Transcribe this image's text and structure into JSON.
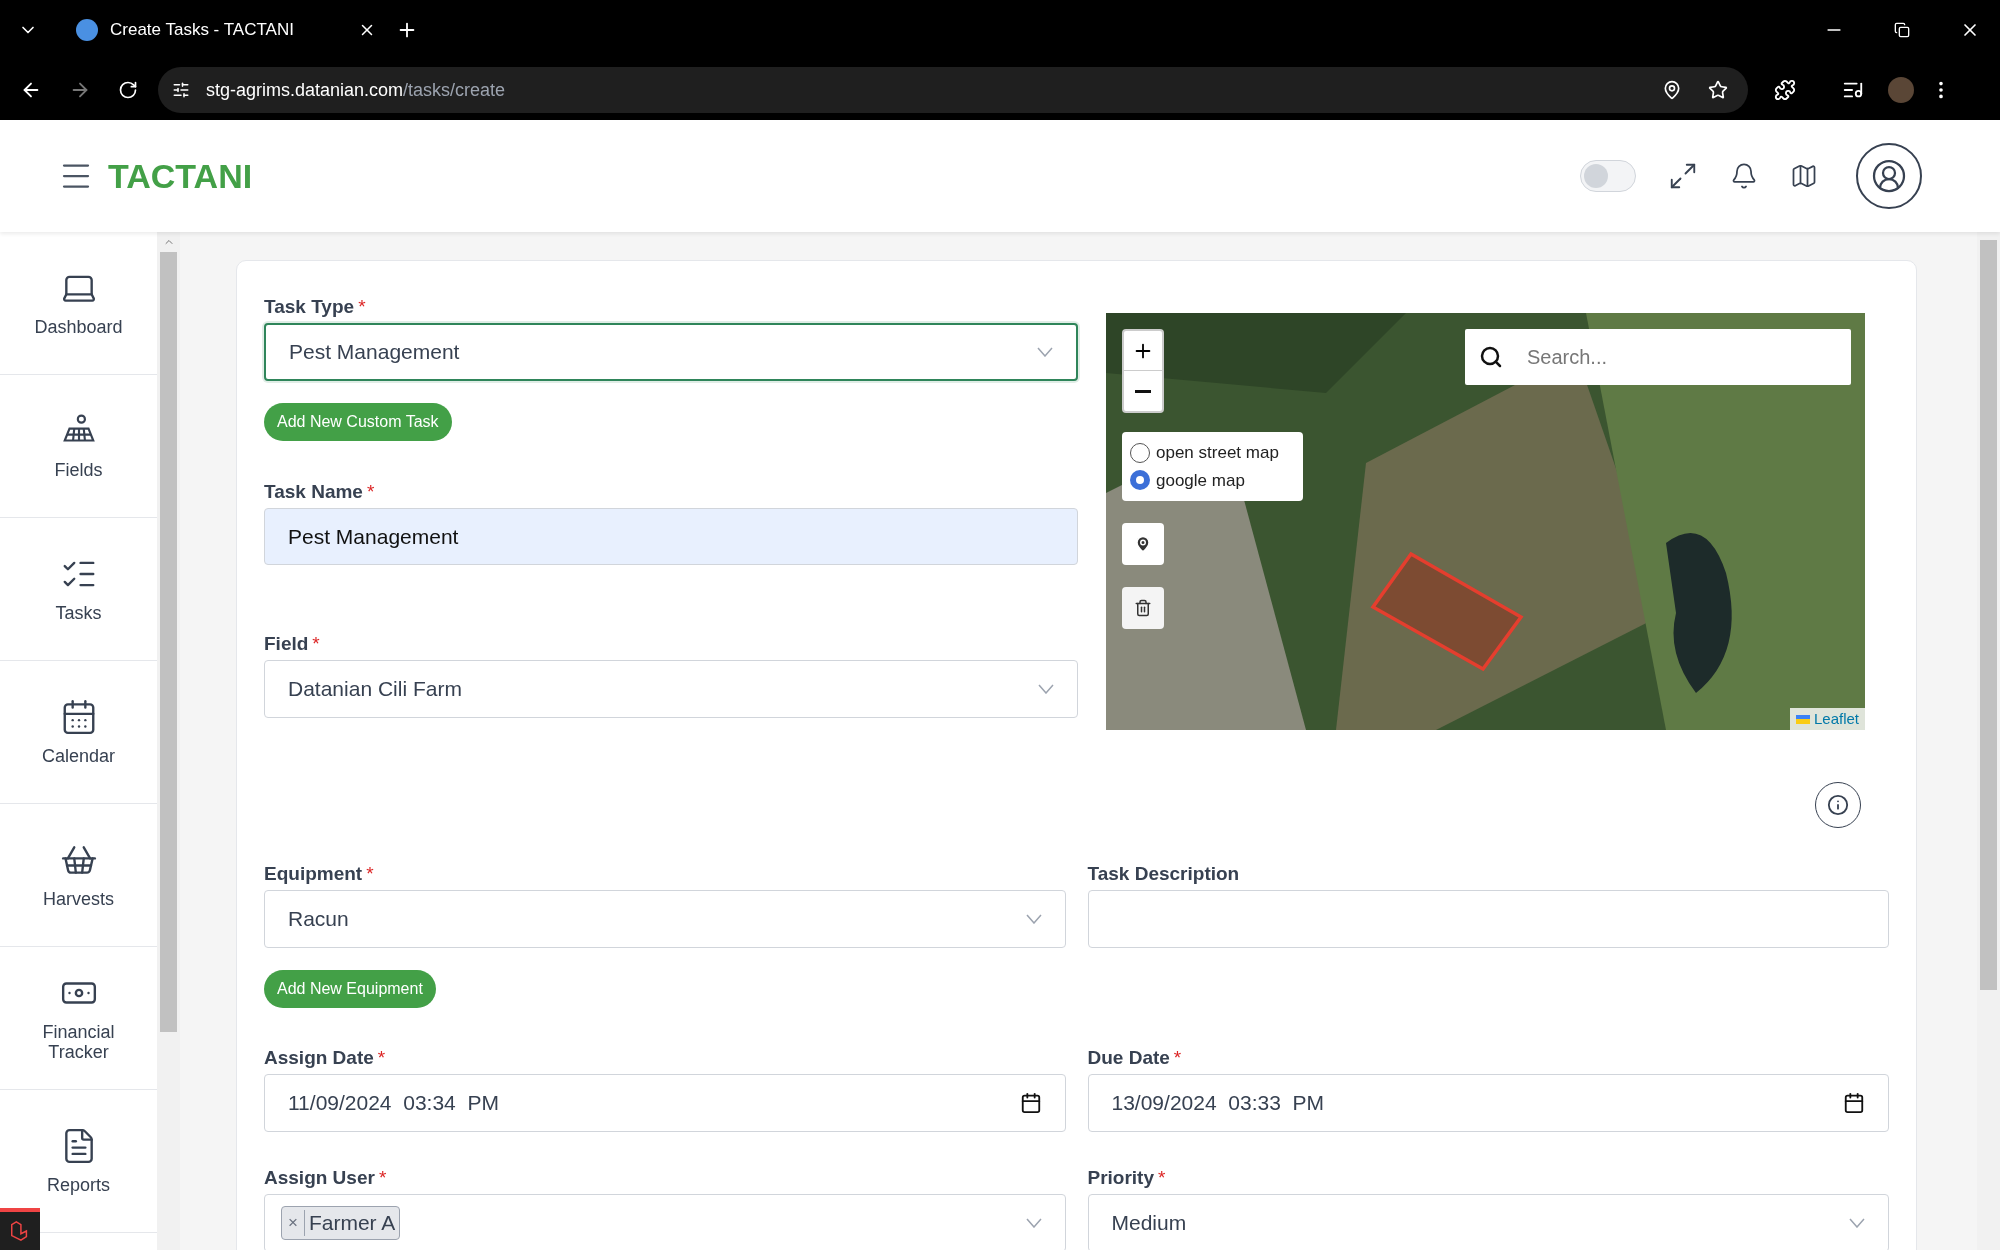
{
  "browser": {
    "tab_title": "Create Tasks - TACTANI",
    "url_host": "stg-agrims.datanian.com",
    "url_path": "/tasks/create"
  },
  "header": {
    "brand": "TACTANI",
    "toggle_on": false
  },
  "sidebar": {
    "items": [
      {
        "label": "Dashboard",
        "selected": false
      },
      {
        "label": "Fields",
        "selected": false
      },
      {
        "label": "Tasks",
        "selected": false
      },
      {
        "label": "Calendar",
        "selected": false
      },
      {
        "label": "Harvests",
        "selected": false
      },
      {
        "label": "Financial Tracker",
        "selected": false
      },
      {
        "label": "Reports",
        "selected": false
      }
    ]
  },
  "form": {
    "required_mark": "*",
    "task_type": {
      "label": "Task Type",
      "required": true,
      "value": "Pest Management",
      "focused": true
    },
    "add_custom_task_button": "Add New Custom Task",
    "task_name": {
      "label": "Task Name",
      "required": true,
      "value": "Pest Management"
    },
    "field": {
      "label": "Field",
      "required": true,
      "value": "Datanian Cili Farm"
    },
    "map": {
      "search_placeholder": "Search...",
      "attribution": "Leaflet",
      "layers": [
        {
          "label": "open street map",
          "selected": false
        },
        {
          "label": "google map",
          "selected": true
        }
      ]
    },
    "equipment": {
      "label": "Equipment",
      "required": true,
      "value": "Racun"
    },
    "task_description": {
      "label": "Task Description",
      "required": false
    },
    "add_equipment_button": "Add New Equipment",
    "assign_date": {
      "label": "Assign Date",
      "required": true,
      "value": "11/09/2024  03:34  PM"
    },
    "due_date": {
      "label": "Due Date",
      "required": true,
      "value": "13/09/2024  03:33  PM"
    },
    "assign_user": {
      "label": "Assign User",
      "required": true,
      "tags": [
        "Farmer A"
      ],
      "remove_glyph": "×"
    },
    "priority": {
      "label": "Priority",
      "required": true,
      "value": "Medium"
    }
  }
}
